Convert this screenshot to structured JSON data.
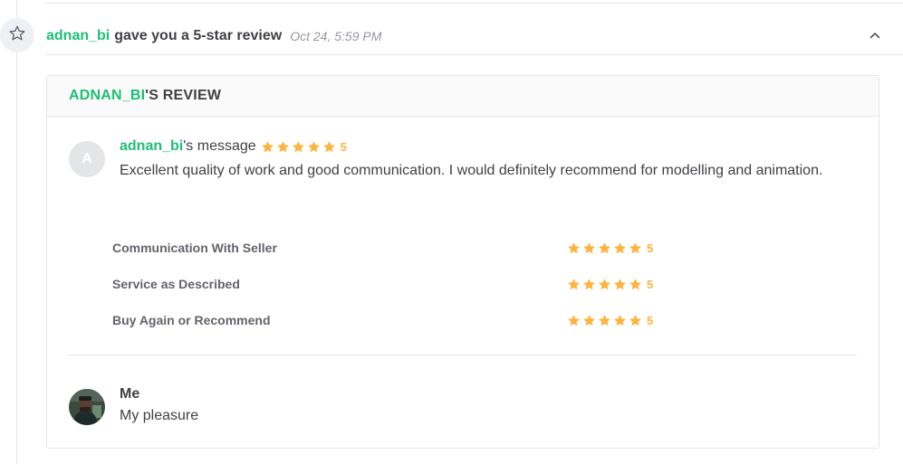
{
  "event": {
    "user": "adnan_bi",
    "action": "gave you a 5-star review",
    "time": "Oct 24, 5:59 PM"
  },
  "review": {
    "header_user": "ADNAN_BI",
    "header_suffix": "'S REVIEW",
    "avatar_letter": "A",
    "author": "adnan_bi",
    "author_suffix": "'s message",
    "overall_rating": "5",
    "message": "Excellent quality of work and good communication. I would definitely recommend for modelling and animation.",
    "criteria": [
      {
        "label": "Communication With Seller",
        "rating": "5"
      },
      {
        "label": "Service as Described",
        "rating": "5"
      },
      {
        "label": "Buy Again or Recommend",
        "rating": "5"
      }
    ]
  },
  "reply": {
    "name": "Me",
    "text": "My pleasure"
  },
  "colors": {
    "accent": "#1dbf73",
    "star": "#ffb33e",
    "text": "#404145",
    "muted": "#95979d"
  },
  "icons": {
    "event": "star-outline-icon",
    "collapse": "chevron-up-icon",
    "rating": "star-icon"
  }
}
